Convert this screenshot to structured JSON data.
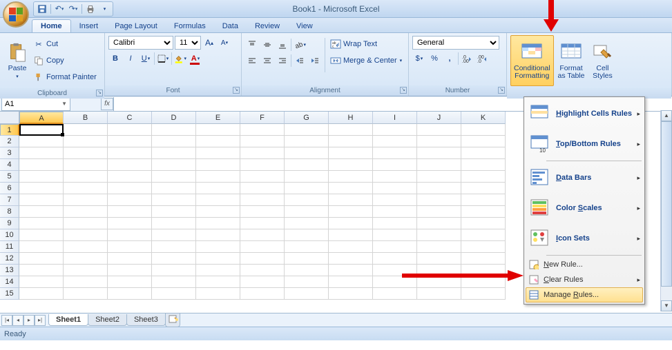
{
  "title": "Book1 - Microsoft Excel",
  "qat": {
    "save": "💾",
    "undo": "↶",
    "redo": "↷",
    "print": "🖨"
  },
  "tabs": [
    "Home",
    "Insert",
    "Page Layout",
    "Formulas",
    "Data",
    "Review",
    "View"
  ],
  "active_tab": 0,
  "clipboard": {
    "paste": "Paste",
    "cut": "Cut",
    "copy": "Copy",
    "fp": "Format Painter",
    "label": "Clipboard"
  },
  "font": {
    "name": "Calibri",
    "size": "11",
    "label": "Font"
  },
  "alignment": {
    "wrap": "Wrap Text",
    "merge": "Merge & Center",
    "label": "Alignment"
  },
  "number": {
    "format": "General",
    "label": "Number"
  },
  "styles": {
    "cf": "Conditional\nFormatting",
    "fat": "Format\nas Table",
    "cs": "Cell\nStyles"
  },
  "name_box": "A1",
  "columns": [
    "A",
    "B",
    "C",
    "D",
    "E",
    "F",
    "G",
    "H",
    "I",
    "J",
    "K"
  ],
  "rows": [
    1,
    2,
    3,
    4,
    5,
    6,
    7,
    8,
    9,
    10,
    11,
    12,
    13,
    14,
    15
  ],
  "sheets": [
    "Sheet1",
    "Sheet2",
    "Sheet3"
  ],
  "active_sheet": 0,
  "status": "Ready",
  "cf_menu": {
    "big": [
      {
        "label": "Highlight Cells Rules",
        "u": 0,
        "name": "highlight-cells"
      },
      {
        "label": "Top/Bottom Rules",
        "u": 0,
        "name": "top-bottom"
      },
      {
        "label": "Data Bars",
        "u": 0,
        "name": "data-bars"
      },
      {
        "label": "Color Scales",
        "u": 6,
        "name": "color-scales"
      },
      {
        "label": "Icon Sets",
        "u": 0,
        "name": "icon-sets"
      }
    ],
    "small": [
      {
        "label": "New Rule...",
        "u": 0,
        "name": "new-rule",
        "arrow": false
      },
      {
        "label": "Clear Rules",
        "u": 0,
        "name": "clear-rules",
        "arrow": true
      },
      {
        "label": "Manage Rules...",
        "u": 7,
        "name": "manage-rules",
        "arrow": false,
        "hover": true
      }
    ]
  }
}
